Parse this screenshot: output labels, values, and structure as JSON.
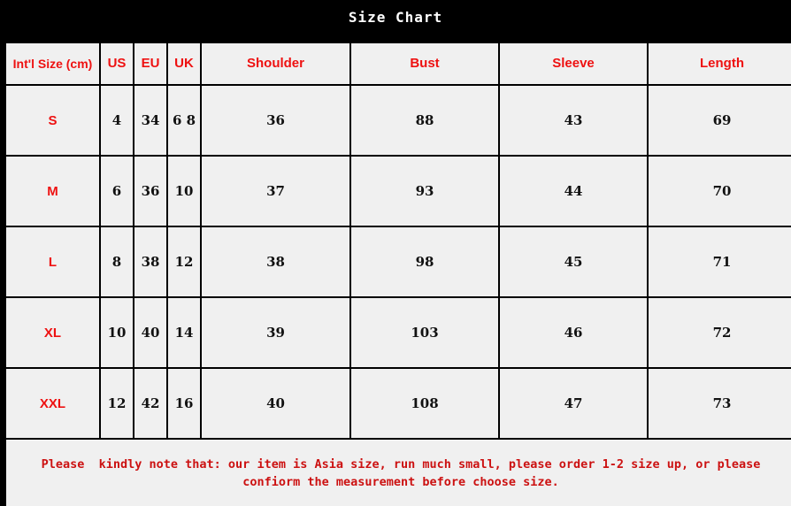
{
  "title": "Size Chart",
  "table": {
    "headers": [
      "Int'l Size (cm)",
      "US",
      "EU",
      "UK",
      "Shoulder",
      "Bust",
      "Sleeve",
      "Length"
    ],
    "rows": [
      {
        "size": "S",
        "us": "4",
        "eu": "34",
        "uk": "6 8",
        "shoulder": "36",
        "bust": "88",
        "sleeve": "43",
        "length": "69"
      },
      {
        "size": "M",
        "us": "6",
        "eu": "36",
        "uk": "10",
        "shoulder": "37",
        "bust": "93",
        "sleeve": "44",
        "length": "70"
      },
      {
        "size": "L",
        "us": "8",
        "eu": "38",
        "uk": "12",
        "shoulder": "38",
        "bust": "98",
        "sleeve": "45",
        "length": "71"
      },
      {
        "size": "XL",
        "us": "10",
        "eu": "40",
        "uk": "14",
        "shoulder": "39",
        "bust": "103",
        "sleeve": "46",
        "length": "72"
      },
      {
        "size": "XXL",
        "us": "12",
        "eu": "42",
        "uk": "16",
        "shoulder": "40",
        "bust": "108",
        "sleeve": "47",
        "length": "73"
      }
    ]
  },
  "footer": {
    "note": "Please  kindly note that: our item is Asia size, run much small, please order 1-2 size up, or please confiorm the measurement before choose size."
  },
  "colors": {
    "background": "#000000",
    "cell": "#f0f0f0",
    "header_text": "#ee1111",
    "value_text": "#111111",
    "title_text": "#ffffff",
    "note_text": "#cc1111"
  }
}
